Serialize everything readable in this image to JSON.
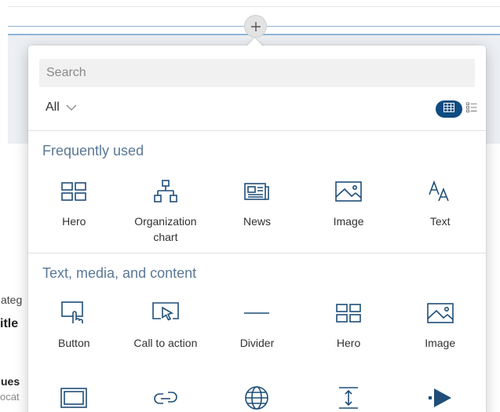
{
  "toolbox": {
    "search_placeholder": "Search",
    "filter_label": "All",
    "active_view": "grid",
    "accent_color": "#0f4c81",
    "sections": [
      {
        "title": "Frequently used",
        "items": [
          {
            "label": "Hero",
            "icon": "hero-icon"
          },
          {
            "label": "Organization chart",
            "icon": "org-chart-icon"
          },
          {
            "label": "News",
            "icon": "news-icon"
          },
          {
            "label": "Image",
            "icon": "image-icon"
          },
          {
            "label": "Text",
            "icon": "text-icon"
          }
        ]
      },
      {
        "title": "Text, media, and content",
        "items": [
          {
            "label": "Button",
            "icon": "button-icon"
          },
          {
            "label": "Call to action",
            "icon": "call-to-action-icon"
          },
          {
            "label": "Divider",
            "icon": "divider-icon"
          },
          {
            "label": "Hero",
            "icon": "hero-icon"
          },
          {
            "label": "Image",
            "icon": "image-icon"
          }
        ]
      },
      {
        "title": "",
        "items": [
          {
            "label": "",
            "icon": "embed-icon"
          },
          {
            "label": "",
            "icon": "link-icon"
          },
          {
            "label": "",
            "icon": "globe-icon"
          },
          {
            "label": "",
            "icon": "spacer-icon"
          },
          {
            "label": "",
            "icon": "stream-icon"
          }
        ]
      }
    ]
  },
  "background": {
    "fragments": [
      "ateg",
      "itle",
      "ues",
      "ocat"
    ]
  }
}
